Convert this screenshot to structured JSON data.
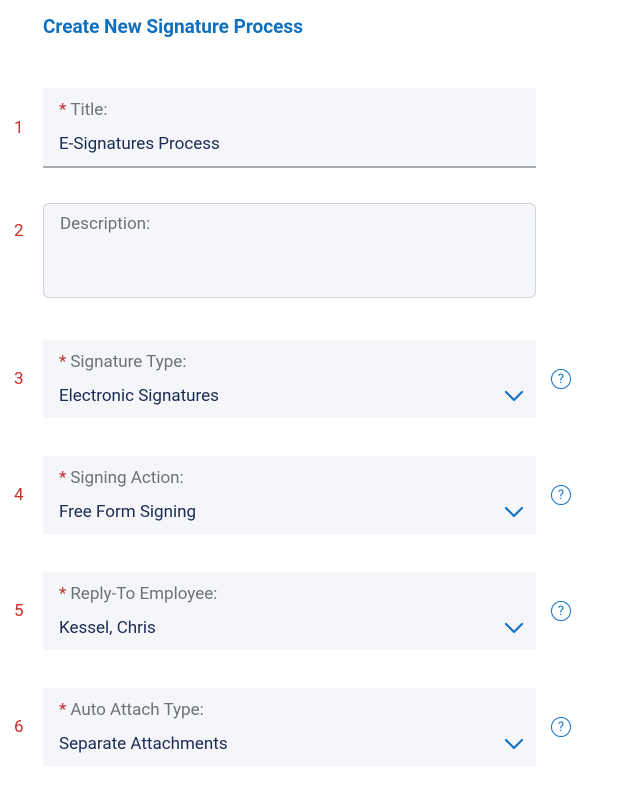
{
  "header": {
    "title": "Create New Signature Process"
  },
  "rows": {
    "r1": {
      "num": "1"
    },
    "r2": {
      "num": "2"
    },
    "r3": {
      "num": "3"
    },
    "r4": {
      "num": "4"
    },
    "r5": {
      "num": "5"
    },
    "r6": {
      "num": "6"
    }
  },
  "fields": {
    "title": {
      "label": "Title:",
      "value": "E-Signatures Process"
    },
    "description": {
      "label": "Description:",
      "value": ""
    },
    "signature_type": {
      "label": "Signature Type:",
      "value": "Electronic Signatures"
    },
    "signing_action": {
      "label": "Signing Action:",
      "value": "Free Form Signing"
    },
    "reply_to": {
      "label": "Reply-To Employee:",
      "value": "Kessel, Chris"
    },
    "auto_attach": {
      "label": "Auto Attach Type:",
      "value": "Separate Attachments"
    }
  },
  "required_marker": "*",
  "help_char": "?"
}
